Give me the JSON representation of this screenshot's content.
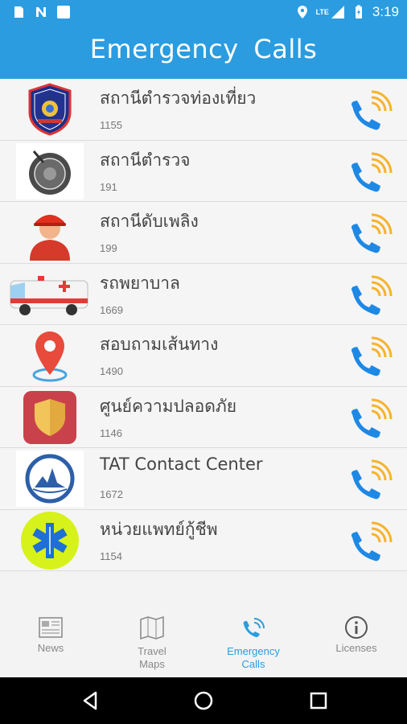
{
  "status_bar": {
    "time": "3:19",
    "network_label": "LTE",
    "icons": [
      "sd-card-icon",
      "n-icon",
      "square-icon",
      "location-icon",
      "signal-icon",
      "battery-icon"
    ]
  },
  "app_bar": {
    "title": "Emergency Calls"
  },
  "contacts": [
    {
      "name": "สถานีตำรวจท่องเที่ยว",
      "number": "1155",
      "icon": "tourist-police-badge-icon"
    },
    {
      "name": "สถานีตำรวจ",
      "number": "191",
      "icon": "police-emblem-icon"
    },
    {
      "name": "สถานีดับเพลิง",
      "number": "199",
      "icon": "firefighter-icon"
    },
    {
      "name": "รถพยาบาล",
      "number": "1669",
      "icon": "ambulance-icon"
    },
    {
      "name": "สอบถามเส้นทาง",
      "number": "1490",
      "icon": "map-pin-icon"
    },
    {
      "name": "ศูนย์ความปลอดภัย",
      "number": "1146",
      "icon": "shield-icon"
    },
    {
      "name": "TAT Contact Center",
      "number": "1672",
      "icon": "tat-logo-icon"
    },
    {
      "name": "หน่วยแพทย์กู้ชีพ",
      "number": "1154",
      "icon": "star-of-life-icon"
    }
  ],
  "bottom_nav": [
    {
      "label": "News",
      "icon": "news-icon",
      "active": false
    },
    {
      "label": "Travel\nMaps",
      "icon": "map-icon",
      "active": false
    },
    {
      "label": "Emergency\nCalls",
      "icon": "phone-call-icon",
      "active": true
    },
    {
      "label": "Licenses",
      "icon": "info-icon",
      "active": false
    }
  ],
  "colors": {
    "primary": "#2b9cdf",
    "call_blue": "#1e88e5",
    "wave_orange": "#f6b32b"
  }
}
